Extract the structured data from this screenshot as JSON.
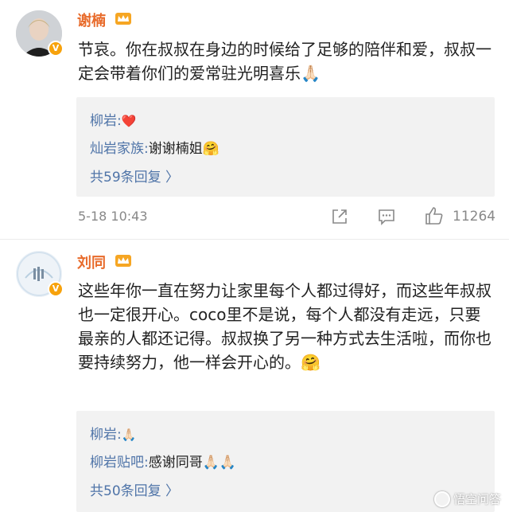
{
  "comments": [
    {
      "author": "谢楠",
      "text": "节哀。你在叔叔在身边的时候给了足够的陪伴和爱，叔叔一定会带着你们的爱常驻光明喜乐🙏🏻",
      "replies": [
        {
          "who": "柳岩:",
          "text": "❤️"
        },
        {
          "who": "灿岩家族:",
          "text": "谢谢楠姐🤗"
        }
      ],
      "more_replies": "共59条回复 〉",
      "timestamp": "5-18 10:43",
      "likes": "11264"
    },
    {
      "author": "刘同",
      "text": "这些年你一直在努力让家里每个人都过得好，而这些年叔叔也一定很开心。coco里不是说，每个人都没有走远，只要最亲的人都还记得。叔叔换了另一种方式去生活啦，而你也要持续努力，他一样会开心的。🤗",
      "replies": [
        {
          "who": "柳岩:",
          "text": "🙏🏻"
        },
        {
          "who": "柳岩贴吧:",
          "text": "感谢同哥🙏🏻🙏🏻"
        }
      ],
      "more_replies": "共50条回复 〉"
    }
  ],
  "icons": {
    "verified": "v-badge-icon",
    "crown": "crown-icon",
    "share": "share-icon",
    "comment": "comment-icon",
    "like": "thumbs-up-icon"
  },
  "colors": {
    "author_name": "#e86b2b",
    "reply_user": "#4f74a8",
    "reply_bg": "#f2f2f2",
    "meta": "#888888"
  },
  "watermark": "悟空问答"
}
